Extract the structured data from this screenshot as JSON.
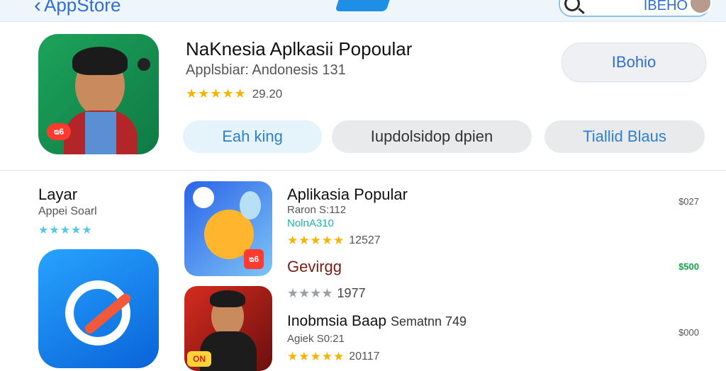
{
  "topbar": {
    "back_label": "AppStore",
    "search_value": "IBEHO"
  },
  "featured": {
    "title": "NaKnesia Aplkasii Popoular",
    "subtitle": "Applsbiar: Andonesis 131",
    "stars": "★★★★★",
    "rating_count": "29.20",
    "icon_badge": "ᴓ6",
    "get_button": "IBohio",
    "pills": [
      "Eah king",
      "Iupdolsidop dpien",
      "Tiallid Blaus"
    ]
  },
  "left_panel": {
    "title": "Layar",
    "subtitle": "Appei Soarl",
    "stars": "★★★★★"
  },
  "list": {
    "app1": {
      "title": "Aplikasia Popular",
      "subtitle": "Raron S:112",
      "tag": "NolnA310",
      "stars": "★★★★★",
      "rating_count": "12527",
      "genre": "Gevirgg",
      "price": "$027",
      "price_alt": "$500",
      "badge": "ᴓ6"
    },
    "app2": {
      "stars_partial": "★★★★",
      "rating_count": "1977",
      "title": "Inobmsia Baap",
      "title_light": "Sematnn 749",
      "subtitle": "Agiek S0:21",
      "stars": "★★★★★",
      "rating_count_2": "20117",
      "price": "$000",
      "badge": "ON"
    }
  }
}
